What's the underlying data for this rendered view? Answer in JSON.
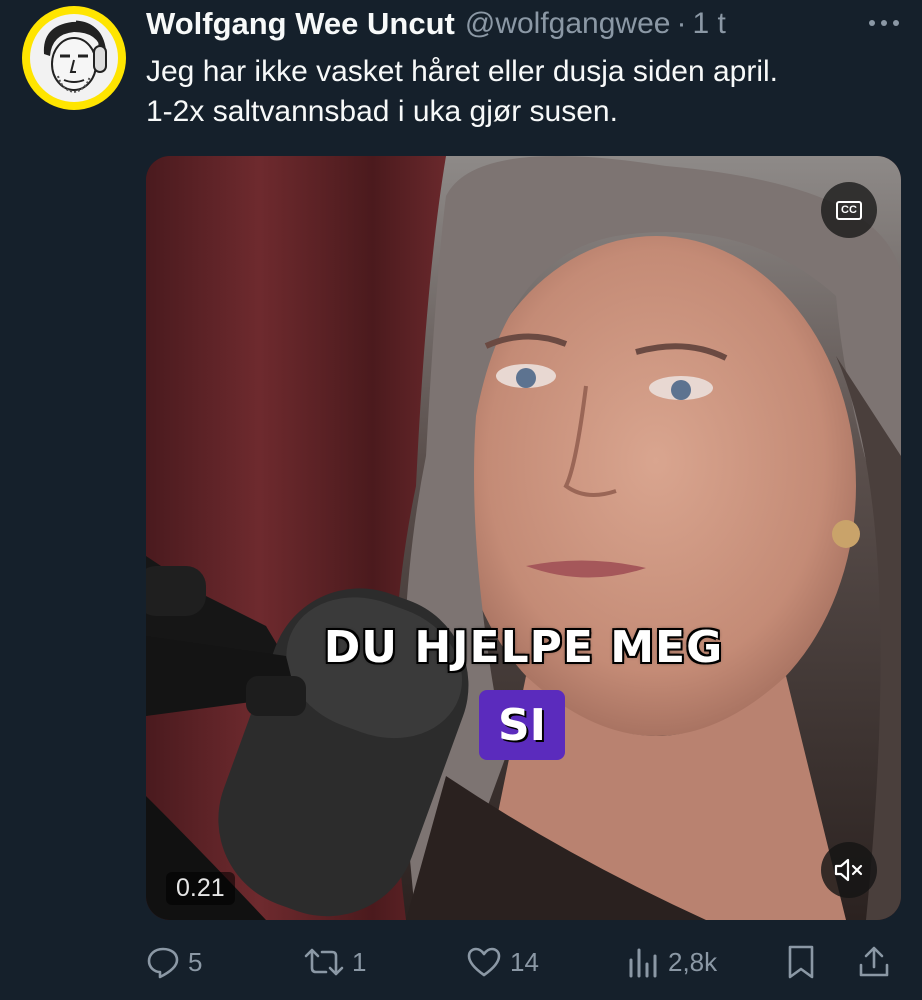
{
  "tweet": {
    "display_name": "Wolfgang Wee Uncut",
    "handle": "@wolfgangwee",
    "separator": "·",
    "time": "1 t",
    "text_lines": [
      "Jeg har ikke vasket håret eller dusja siden april.",
      "1-2x saltvannsbad i uka gjør susen."
    ]
  },
  "video": {
    "caption_line1": "DU HJELPE MEG",
    "caption_highlight": "SI",
    "highlight_color": "#5b2bbd",
    "timestamp": "0.21",
    "cc_label": "CC"
  },
  "actions": {
    "replies": "5",
    "reposts": "1",
    "likes": "14",
    "views": "2,8k"
  },
  "colors": {
    "background": "#15202b",
    "text_primary": "#f7f9f9",
    "text_secondary": "#8b98a5",
    "avatar_ring": "#ffe500"
  },
  "icons": [
    "more-icon",
    "closed-captions-icon",
    "mute-icon",
    "reply-icon",
    "repost-icon",
    "like-icon",
    "views-icon",
    "bookmark-icon",
    "share-icon"
  ]
}
